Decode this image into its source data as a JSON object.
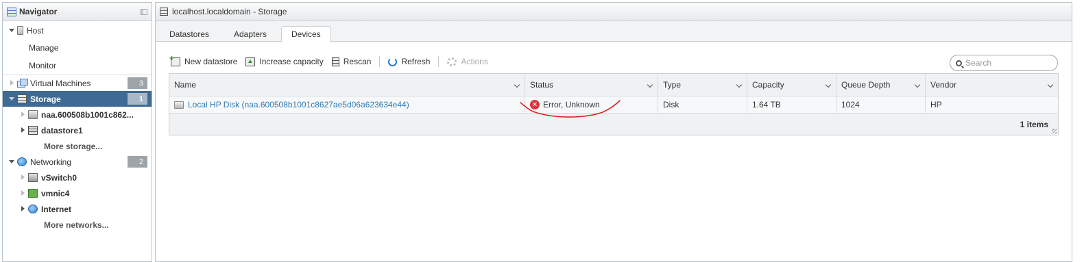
{
  "navigator": {
    "title": "Navigator",
    "host": {
      "label": "Host",
      "links": [
        "Manage",
        "Monitor"
      ]
    },
    "virtual_machines": {
      "label": "Virtual Machines",
      "count": "3"
    },
    "storage": {
      "label": "Storage",
      "count": "1",
      "children": [
        "naa.600508b1001c862...",
        "datastore1"
      ],
      "more": "More storage..."
    },
    "networking": {
      "label": "Networking",
      "count": "2",
      "children": [
        "vSwitch0",
        "vmnic4",
        "Internet"
      ],
      "more": "More networks..."
    }
  },
  "main": {
    "title": "localhost.localdomain - Storage",
    "tabs": [
      "Datastores",
      "Adapters",
      "Devices"
    ],
    "active_tab": "Devices",
    "toolbar": {
      "new_datastore": "New datastore",
      "increase_capacity": "Increase capacity",
      "rescan": "Rescan",
      "refresh": "Refresh",
      "actions": "Actions"
    },
    "search": {
      "placeholder": "Search",
      "value": ""
    },
    "table": {
      "columns": [
        "Name",
        "Status",
        "Type",
        "Capacity",
        "Queue Depth",
        "Vendor"
      ],
      "rows": [
        {
          "name": "Local HP Disk (naa.600508b1001c8627ae5d06a623634e44)",
          "status": "Error, Unknown",
          "type": "Disk",
          "capacity": "1.64 TB",
          "queue_depth": "1024",
          "vendor": "HP"
        }
      ],
      "footer": "1 items"
    }
  },
  "colors": {
    "selected_bg": "#3f6a93",
    "link": "#2b7ab3",
    "error": "#d9363e",
    "annotation": "#e02020"
  }
}
